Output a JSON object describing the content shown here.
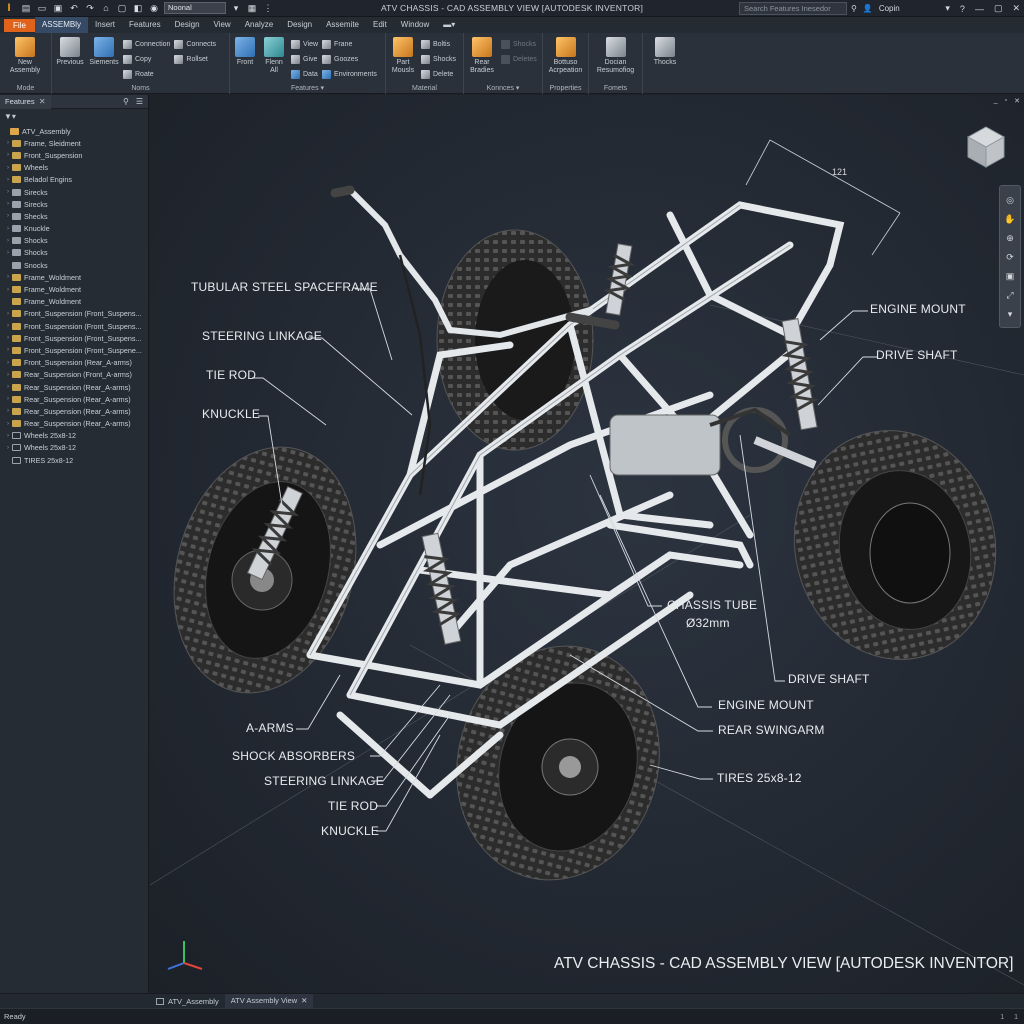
{
  "window": {
    "title": "ATV CHASSIS - CAD ASSEMBLY VIEW [AUTODESK INVENTOR]",
    "doc_select": "Noonal",
    "search_placeholder": "Search Features Inesedor",
    "user_label": "Copin"
  },
  "menu": {
    "file": "File",
    "items": [
      "ASSEMBly",
      "Insert",
      "Features",
      "Design",
      "View",
      "Analyze",
      "Design",
      "Assemite",
      "Edit",
      "Window"
    ],
    "active_index": 0
  },
  "ribbon": {
    "mode": {
      "name": "Mode",
      "new_label_1": "New",
      "new_label_2": "Assembly"
    },
    "noms": {
      "name": "Noms",
      "previous": "Previous",
      "siements": "Siements",
      "connection": "Connection",
      "copy": "Copy",
      "roate": "Roate",
      "connects": "Connects",
      "rollset": "Rollset"
    },
    "features": {
      "name": "Features",
      "front": "Front",
      "flenn_1": "Flenn",
      "flenn_2": "All",
      "view": "View",
      "give": "Give",
      "data": "Data",
      "frane": "Frane",
      "goozes": "Goozes",
      "environments": "Environments"
    },
    "material": {
      "name": "Material",
      "part_1": "Part",
      "part_2": "Mousls",
      "boltis": "Boltis",
      "shocks": "Shocks",
      "delete": "Delete"
    },
    "konnces": {
      "name": "Konnces",
      "rear_1": "Rear",
      "rear_2": "Bradies",
      "shocks": "Shocks",
      "deletes": "Deletes"
    },
    "properties": {
      "name": "Properties",
      "btn_1": "Bottuso",
      "btn_2": "Acrpeation"
    },
    "fomets": {
      "name": "Fomets",
      "btn_1": "Docian",
      "btn_2": "Resumofiog"
    },
    "thocks": {
      "btn": "Thocks"
    }
  },
  "panel": {
    "tab": "Features",
    "tree": [
      {
        "label": "ATV_Assembly",
        "icon": "asm",
        "indent": 0,
        "arrow": ""
      },
      {
        "label": "Frame, Sleidment",
        "icon": "sub",
        "indent": 1,
        "arrow": "›"
      },
      {
        "label": "Front_Suspension",
        "icon": "sub",
        "indent": 1,
        "arrow": "›"
      },
      {
        "label": "Wheels",
        "icon": "sub",
        "indent": 1,
        "arrow": "›"
      },
      {
        "label": "Beladol Engins",
        "icon": "sub",
        "indent": 1,
        "arrow": "›"
      },
      {
        "label": "Sirecks",
        "icon": "part",
        "indent": 1,
        "arrow": "›"
      },
      {
        "label": "Sirecks",
        "icon": "part",
        "indent": 1,
        "arrow": "›"
      },
      {
        "label": "Shecks",
        "icon": "part",
        "indent": 1,
        "arrow": "›"
      },
      {
        "label": "Knuckle",
        "icon": "part",
        "indent": 1,
        "arrow": "›"
      },
      {
        "label": "Shocks",
        "icon": "part",
        "indent": 1,
        "arrow": "›"
      },
      {
        "label": "Shocks",
        "icon": "part",
        "indent": 1,
        "arrow": "›"
      },
      {
        "label": "Snocks",
        "icon": "part",
        "indent": 1,
        "arrow": ""
      },
      {
        "label": "Frame_Woldment",
        "icon": "sub",
        "indent": 1,
        "arrow": "›"
      },
      {
        "label": "Frame_Woldment",
        "icon": "sub",
        "indent": 1,
        "arrow": "›"
      },
      {
        "label": "Frame_Woldment",
        "icon": "sub",
        "indent": 1,
        "arrow": ""
      },
      {
        "label": "Front_Suspension (Front_Suspens...",
        "icon": "sub",
        "indent": 1,
        "arrow": "›"
      },
      {
        "label": "Front_Suspension (Front_Suspens...",
        "icon": "sub",
        "indent": 1,
        "arrow": "›"
      },
      {
        "label": "Front_Suspension (Front_Suspens...",
        "icon": "sub",
        "indent": 1,
        "arrow": "›"
      },
      {
        "label": "Front_Suspension (Front_Suspene...",
        "icon": "sub",
        "indent": 1,
        "arrow": "›"
      },
      {
        "label": "Front_Suspension (Rear_A-arms)",
        "icon": "sub",
        "indent": 1,
        "arrow": "›"
      },
      {
        "label": "Rear_Suspension (Front_A-arms)",
        "icon": "sub",
        "indent": 1,
        "arrow": "›"
      },
      {
        "label": "Rear_Suspension (Rear_A-arms)",
        "icon": "sub",
        "indent": 1,
        "arrow": "›"
      },
      {
        "label": "Rear_Suspension (Rear_A-arms)",
        "icon": "sub",
        "indent": 1,
        "arrow": "›"
      },
      {
        "label": "Rear_Suspension (Rear_A-arms)",
        "icon": "sub",
        "indent": 1,
        "arrow": "›"
      },
      {
        "label": "Rear_Suspension (Rear_A-arms)",
        "icon": "sub",
        "indent": 1,
        "arrow": "›"
      },
      {
        "label": "Wheels 25x8-12",
        "icon": "wheel",
        "indent": 1,
        "arrow": "›"
      },
      {
        "label": "Wheels 25x8-12",
        "icon": "wheel",
        "indent": 1,
        "arrow": "›"
      },
      {
        "label": "TIRES 25x8-12",
        "icon": "wheel",
        "indent": 1,
        "arrow": ""
      }
    ]
  },
  "viewport": {
    "dimension": "121",
    "callouts": {
      "tubular_frame": "TUBULAR STEEL SPACEFRAME",
      "steering_linkage_top": "STEERING LINKAGE",
      "tie_rod_top": "TIE ROD",
      "knuckle_top": "KNUCKLE",
      "engine_mount_top": "ENGINE MOUNT",
      "drive_shaft_top": "DRIVE SHAFT",
      "chassis_tube_1": "CHASSIS TUBE",
      "chassis_tube_2": "Ø32mm",
      "drive_shaft_bottom": "DRIVE SHAFT",
      "engine_mount_bottom": "ENGINE MOUNT",
      "rear_swingarm": "REAR SWINGARM",
      "tires": "TIRES 25x8-12",
      "a_arms": "A-ARMS",
      "shock_absorbers": "SHOCK ABSORBERS",
      "steering_linkage_bottom": "STEERING LINKAGE",
      "tie_rod_bottom": "TIE ROD",
      "knuckle_bottom": "KNUCKLE"
    },
    "caption": "ATV CHASSIS - CAD ASSEMBLY VIEW [AUTODESK INVENTOR]"
  },
  "doctabs": {
    "tab1": "ATV_Assembly",
    "tab2": "ATV Assembly View"
  },
  "status": {
    "text": "Ready",
    "page": "1",
    "count": "1"
  },
  "colors": {
    "accent": "#e0631c",
    "active_tab": "#4f8ad9",
    "background": "#222831"
  }
}
